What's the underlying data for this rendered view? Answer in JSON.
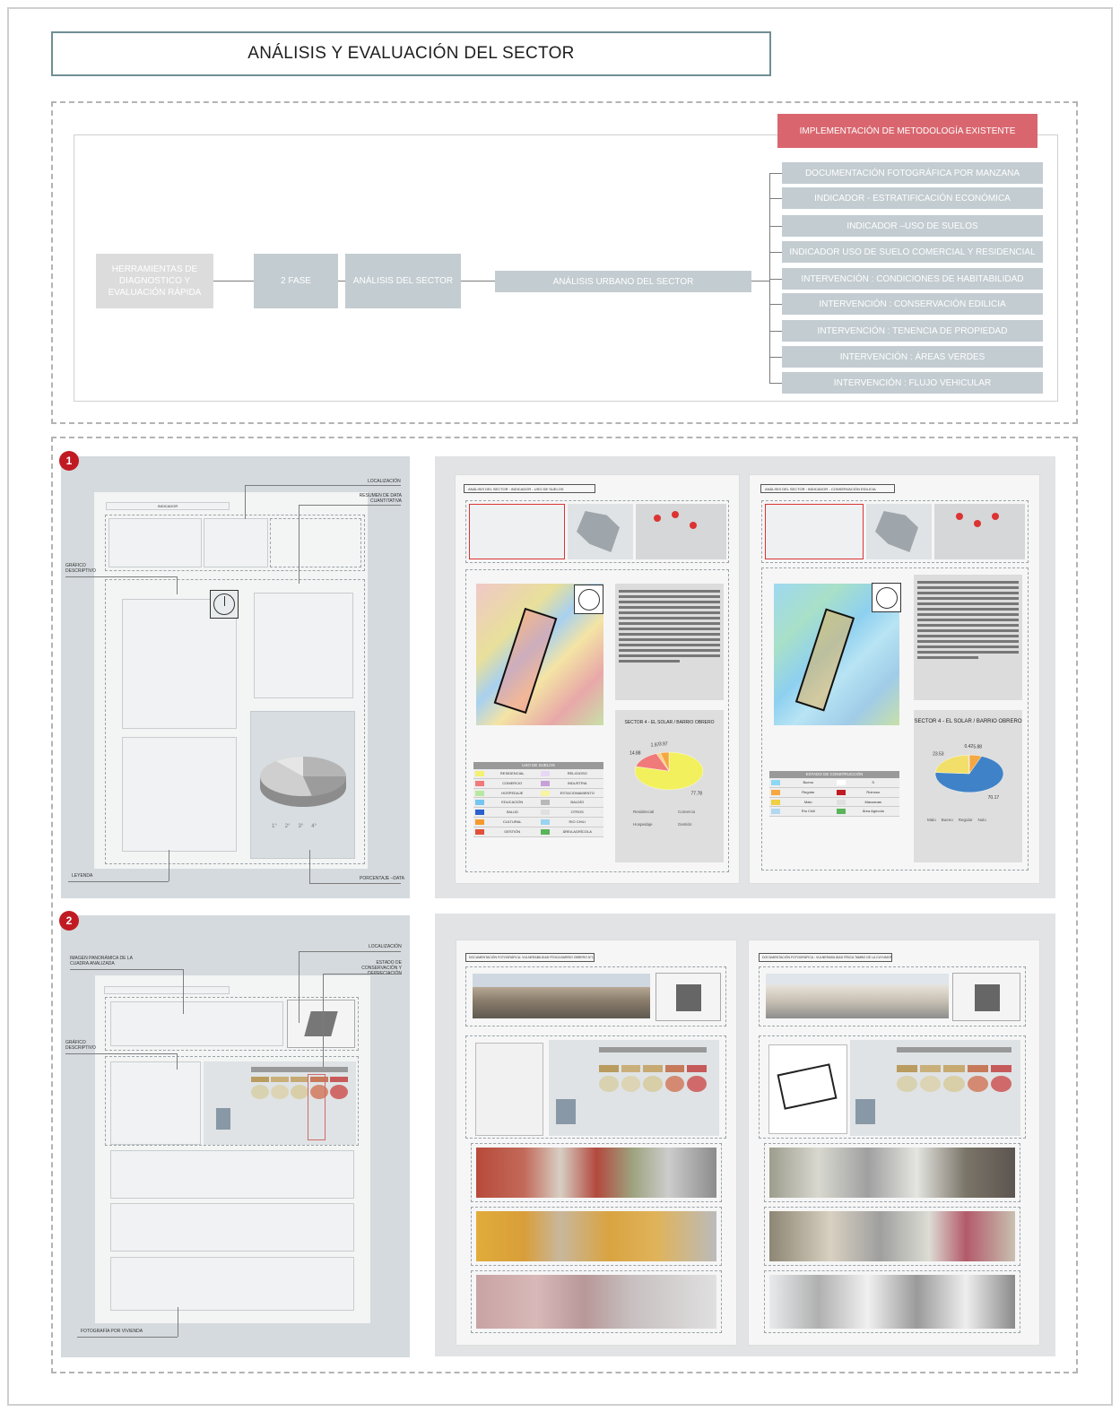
{
  "title": "ANÁLISIS Y EVALUACIÓN  DEL SECTOR",
  "diagram": {
    "header_label": "IMPLEMENTACIÓN DE METODOLOGÍA EXISTENTE",
    "root": "HERRAMIENTAS DE DIAGNOSTICO Y EVALUACIÓN RÁPIDA",
    "phase": "2 FASE",
    "analysis": "ANÁLISIS DEL SECTOR",
    "urban": "ANÁLISIS URBANO DEL SECTOR",
    "branches": [
      "DOCUMENTACIÓN FOTOGRÁFICA POR MANZANA",
      "INDICADOR - ESTRATIFICACIÓN ECONÓMICA",
      "INDICADOR –USO DE SUELOS",
      "INDICADOR USO DE SUELO COMERCIAL Y RESIDENCIAL",
      "INTERVENCIÓN : CONDICIONES DE HABITABILIDAD",
      "INTERVENCIÓN : CONSERVACIÓN EDILICIA",
      "INTERVENCIÓN : TENENCIA DE PROPIEDAD",
      "INTERVENCIÓN : ÁREAS VERDES",
      "INTERVENCIÓN : FLUJO VEHICULAR"
    ]
  },
  "template1": {
    "number": "1",
    "indicador": "INDICADOR",
    "localizacion": "LOCALIZACIÓN",
    "resumen": "RESUMEN DE DATA CUANTITATIVA",
    "grafico": "GRÁFICO DESCRIPTIVO",
    "leyenda": "LEYENDA",
    "porcentaje": "PORCENTAJE –DATA",
    "pie_legend": [
      "1°",
      "2°",
      "3°",
      "4°"
    ]
  },
  "template2": {
    "number": "2",
    "localizacion": "LOCALIZACIÓN",
    "imagen": "IMAGEN PANORÁMICA DE LA CUADRA ANALIZADA",
    "estado": "ESTADO DE CONSERVACIÓN Y DEPRECIACIÓN",
    "grafico": "GRÁFICO DESCRIPTIVO",
    "foto": "FOTOGRAFÍA POR VIVIENDA"
  },
  "sheet_a": {
    "header": "ANÁLISIS DEL SECTOR : INDICADOR - USO DE SUELOS",
    "chart_title": "SECTOR 4 - EL SOLAR / BARRIO OBRERO",
    "legend_title": "USO DE SUELOS",
    "legend_left": [
      "RESIDENCIAL",
      "COMERCIO",
      "HOSPEDAJE",
      "EDUCACIÓN",
      "SALUD",
      "CULTURAL",
      "GESTIÓN"
    ],
    "legend_right": [
      "RELIGIOSO",
      "INDUSTRIA",
      "ESTACIONAMIENTO",
      "BALDÍO",
      "OTROS",
      "RIO CHILI",
      "ÁREA AGRÍCOLA"
    ],
    "pie_keys": [
      "Residencial",
      "Comercio",
      "Hospedaje",
      "Gestión"
    ]
  },
  "sheet_b": {
    "header": "ANÁLISIS DEL SECTOR : INDICADOR - CONSERVACIÓN EDILICIA",
    "chart_title": "SECTOR 4 - EL SOLAR / BARRIO OBRERO",
    "legend_title": "ESTADO DE CONSTRUCCIÓN",
    "legend_left": [
      "Bueno",
      "Regular",
      "Malo",
      "Río Chili"
    ],
    "legend_right": [
      "S",
      "Ruinoso",
      "Manzanas",
      "Área Agrícola"
    ],
    "pie_keys": [
      "Malo",
      "Bueno",
      "Regular",
      "Nulo"
    ]
  },
  "chart_data": [
    {
      "type": "pie",
      "title": "SECTOR 4 - EL SOLAR / BARRIO OBRERO",
      "categories": [
        "Residencial",
        "Comercio",
        "Hospedaje",
        "Gestión"
      ],
      "values": [
        77.78,
        14.88,
        1.97,
        3.97
      ],
      "colors": [
        "#f2f05c",
        "#f07a7a",
        "#f5d28a",
        "#f5a742"
      ]
    },
    {
      "type": "pie",
      "title": "SECTOR 4 - EL SOLAR / BARRIO OBRERO",
      "categories": [
        "Malo",
        "Bueno",
        "Regular",
        "Nulo"
      ],
      "values": [
        5.88,
        70.17,
        23.53,
        0.42
      ],
      "colors": [
        "#f5a742",
        "#3f82c7",
        "#f2df6a",
        "#d0d0d0"
      ]
    }
  ],
  "sheet_c": {
    "header": "DOCUMENTACIÓN FOTOGRÁFICA: VULNERABILIDAD FÍSICA BARRIO OBRERO N°1"
  },
  "sheet_d": {
    "header": "DOCUMENTACIÓN FOTOGRÁFICA : VULNERABILIDAD FÍSICA TAMBO DE LA CUYUMORADA"
  },
  "colors": {
    "accent": "#d9666e",
    "box": "#c3ccd1",
    "panel": "#d4dadd"
  }
}
